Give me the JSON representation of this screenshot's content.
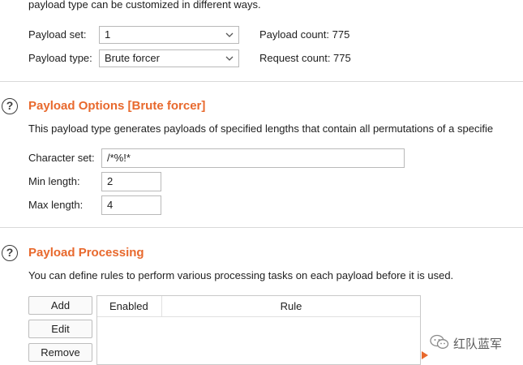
{
  "intro": {
    "text": "payload type can be customized in different ways."
  },
  "payload_sets": {
    "set_label": "Payload set:",
    "set_value": "1",
    "type_label": "Payload type:",
    "type_value": "Brute forcer",
    "payload_count": "Payload count: 775",
    "request_count": "Request count: 775"
  },
  "payload_options": {
    "title": "Payload Options [Brute forcer]",
    "description": "This payload type generates payloads of specified lengths that contain all permutations of a specifie",
    "charset_label": "Character set:",
    "charset_value": "/*%!*",
    "min_label": "Min length:",
    "min_value": "2",
    "max_label": "Max length:",
    "max_value": "4"
  },
  "payload_processing": {
    "title": "Payload Processing",
    "description": "You can define rules to perform various processing tasks on each payload before it is used.",
    "buttons": {
      "add": "Add",
      "edit": "Edit",
      "remove": "Remove"
    },
    "columns": {
      "enabled": "Enabled",
      "rule": "Rule"
    }
  },
  "help_icon_glyph": "?",
  "watermark": {
    "text": "红队蓝军"
  },
  "colors": {
    "accent": "#e8692d",
    "border": "#b9b9b9"
  }
}
